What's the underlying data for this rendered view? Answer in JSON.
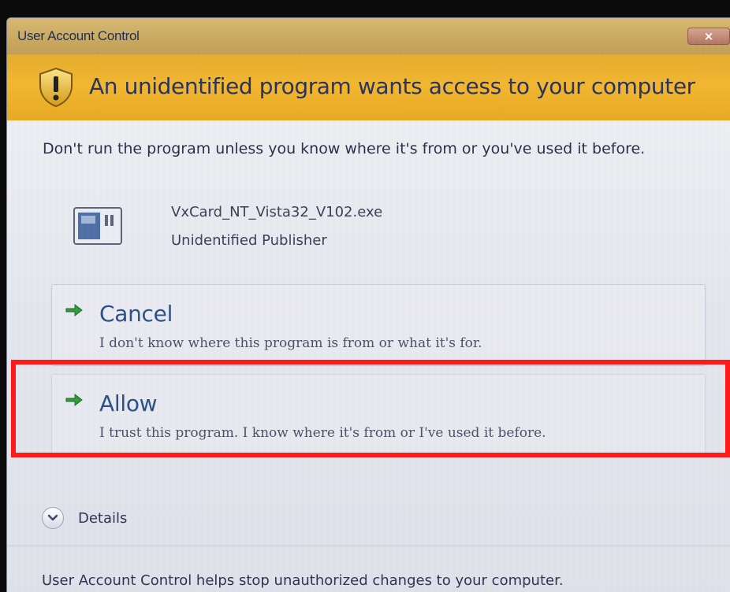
{
  "window": {
    "title": "User Account Control",
    "close_label": "×"
  },
  "banner": {
    "heading": "An unidentified program wants access to your computer",
    "icon": "shield-warning-icon"
  },
  "body": {
    "warning": "Don't run the program unless you know where it's from or you've used it before.",
    "program": {
      "icon": "program-icon",
      "name": "VxCard_NT_Vista32_V102.exe",
      "publisher": "Unidentified Publisher"
    }
  },
  "options": [
    {
      "title": "Cancel",
      "description": "I don't know where this program is from or what it's for.",
      "icon": "arrow-right-icon"
    },
    {
      "title": "Allow",
      "description": "I trust this program. I know where it's from or I've used it before.",
      "icon": "arrow-right-icon",
      "highlighted": true
    }
  ],
  "details": {
    "label": "Details",
    "icon": "chevron-down-icon"
  },
  "footer": {
    "text": "User Account Control helps stop unauthorized changes to your computer."
  },
  "colors": {
    "banner": "#f2b62f",
    "titlebar": "#c9a85e",
    "option_title": "#2b4f86",
    "arrow": "#2f9b3a",
    "highlight": "#ff1a1a"
  }
}
